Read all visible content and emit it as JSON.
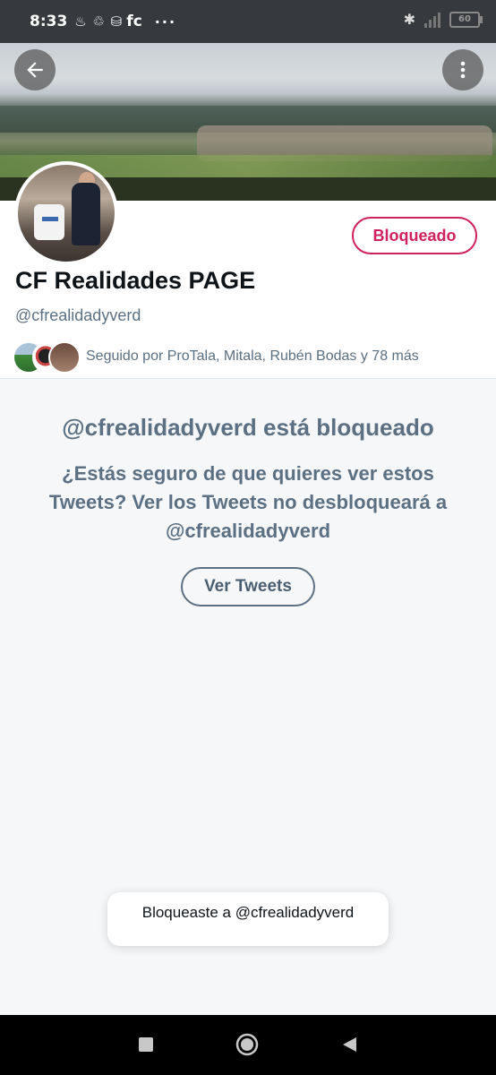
{
  "status_bar": {
    "time": "8:33",
    "notification_icons": "♨ ♲ ⛁",
    "carrier": "fc",
    "more": "···",
    "battery": "60",
    "icons": [
      "bluetooth-icon",
      "signal-icon",
      "battery-icon"
    ]
  },
  "banner": {
    "icons": [
      "back-arrow-icon",
      "more-vertical-icon"
    ]
  },
  "profile": {
    "name": "CF Realidades PAGE",
    "handle": "@cfrealidadyverd",
    "blocked_button_label": "Bloqueado",
    "followed_by": "Seguido por ProTala, Mitala, Rubén Bodas y 78 más"
  },
  "blocked_notice": {
    "title": "@cfrealidadyverd está bloqueado",
    "description": "¿Estás seguro de que quieres ver estos Tweets? Ver los Tweets no desbloqueará a @cfrealidadyverd",
    "view_button_label": "Ver Tweets"
  },
  "toast": {
    "message": "Bloqueaste a @cfrealidadyverd"
  },
  "nav_bar": {
    "icons": [
      "recents-square-icon",
      "home-circle-icon",
      "back-triangle-icon"
    ]
  },
  "colors": {
    "accent_blocked": "#d1205e",
    "secondary_text": "#5b7083",
    "status_bar_bg": "#36393d"
  }
}
